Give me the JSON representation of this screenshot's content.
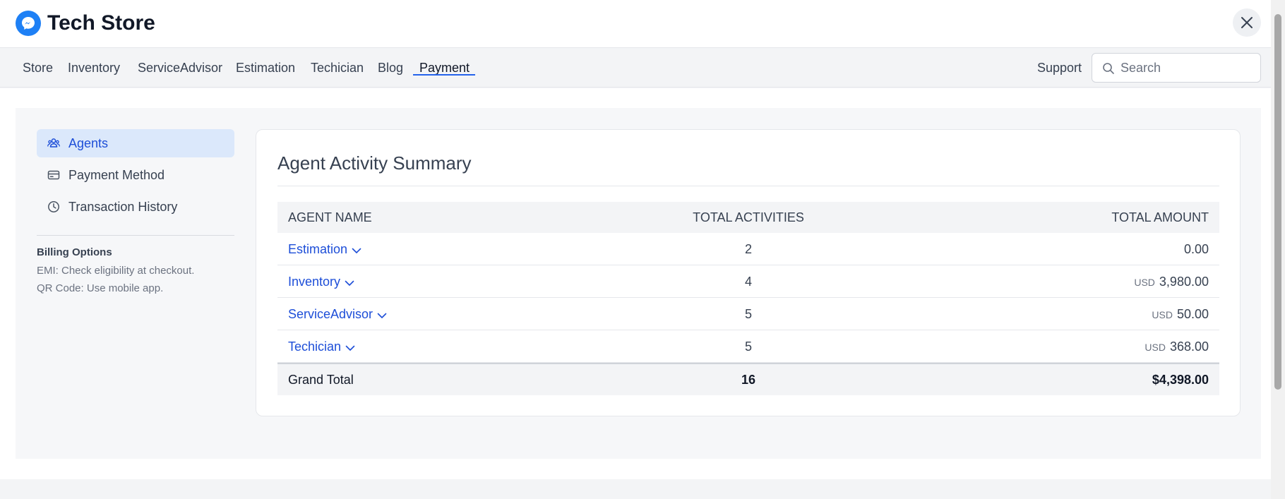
{
  "app": {
    "title": "Tech Store",
    "logo_icon": "messenger-icon",
    "close_icon": "close-icon"
  },
  "nav": {
    "items": [
      "Store",
      "Inventory",
      "ServiceAdvisor",
      "Estimation",
      "Techician",
      "Blog",
      "Payment"
    ],
    "active": "Payment",
    "support_label": "Support",
    "search_placeholder": "Search"
  },
  "sidebar": {
    "items": [
      {
        "label": "Agents",
        "icon": "users-icon",
        "active": true
      },
      {
        "label": "Payment Method",
        "icon": "credit-card-icon",
        "active": false
      },
      {
        "label": "Transaction History",
        "icon": "clock-icon",
        "active": false
      }
    ],
    "billing": {
      "title": "Billing Options",
      "lines": [
        "EMI: Check eligibility at checkout.",
        "QR Code: Use mobile app."
      ]
    }
  },
  "summary": {
    "title": "Agent Activity Summary",
    "columns": [
      "AGENT NAME",
      "TOTAL ACTIVITIES",
      "TOTAL AMOUNT"
    ],
    "rows": [
      {
        "agent": "Estimation",
        "activities": "2",
        "currency": "",
        "amount": "0.00"
      },
      {
        "agent": "Inventory",
        "activities": "4",
        "currency": "USD",
        "amount": "3,980.00"
      },
      {
        "agent": "ServiceAdvisor",
        "activities": "5",
        "currency": "USD",
        "amount": "50.00"
      },
      {
        "agent": "Techician",
        "activities": "5",
        "currency": "USD",
        "amount": "368.00"
      }
    ],
    "total": {
      "label": "Grand Total",
      "activities": "16",
      "amount": "$4,398.00"
    }
  },
  "colors": {
    "accent": "#2563eb",
    "link": "#1d4ed8",
    "active_bg": "#dbe8fb",
    "logo": "#1e80f5"
  }
}
